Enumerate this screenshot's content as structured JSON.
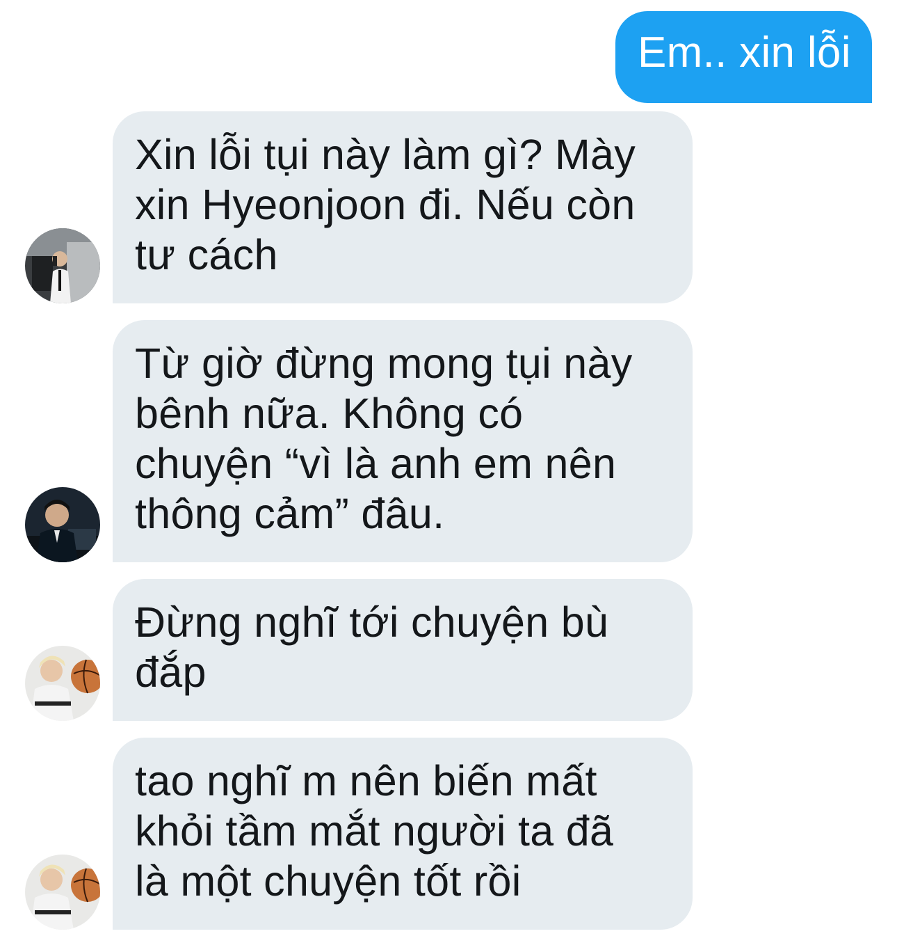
{
  "messages": [
    {
      "direction": "sent",
      "text": "Em.. xin lỗi"
    },
    {
      "direction": "received",
      "lines": [
        "Xin lỗi tụi này làm gì? Mày",
        "xin Hyeonjoon đi. Nếu còn",
        "tư cách"
      ]
    },
    {
      "direction": "received",
      "lines": [
        "Từ giờ đừng mong tụi này",
        "bênh nữa. Không có",
        "chuyện “vì là anh em nên",
        "thông cảm” đâu."
      ]
    },
    {
      "direction": "received",
      "lines": [
        "Đừng nghĩ tới chuyện bù",
        "đắp"
      ]
    },
    {
      "direction": "received",
      "lines": [
        "tao nghĩ m nên biến mất",
        "khỏi tầm mắt người ta đã",
        "là một chuyện tốt rồi"
      ]
    }
  ],
  "colors": {
    "sent_bubble": "#1da1f2",
    "received_bubble": "#e6ecf0",
    "received_text": "#14171a",
    "sent_text": "#ffffff"
  },
  "avatars": [
    "avatar-photo-man-phone",
    "avatar-photo-man-desk",
    "avatar-photo-blond-basketball",
    "avatar-photo-blond-basketball"
  ]
}
